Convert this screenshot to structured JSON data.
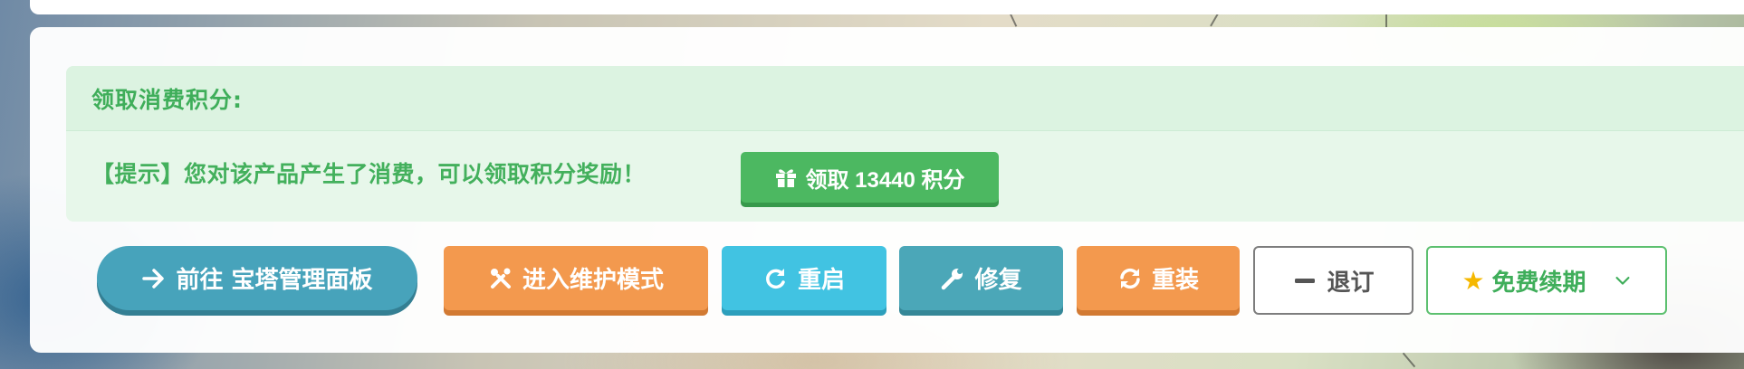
{
  "notice": {
    "title": "领取消费积分:",
    "message": "【提示】您对该产品产生了消费，可以领取积分奖励！",
    "claim_button": "领取 13440 积分"
  },
  "actions": {
    "panel": "前往 宝塔管理面板",
    "maintenance": "进入维护模式",
    "reboot": "重启",
    "repair": "修复",
    "reinstall": "重装",
    "unsubscribe": "退订",
    "renew": "免费续期"
  },
  "icons": {
    "claim": "gift-icon",
    "panel": "arrow-right-icon",
    "maintenance": "tools-icon",
    "reboot": "redo-icon",
    "repair": "wrench-icon",
    "reinstall": "sync-icon",
    "unsubscribe": "minus-icon",
    "renew": "star-icon",
    "renew_caret": "chevron-down-icon"
  },
  "colors": {
    "success": "#4cb861",
    "panel": "#47a3bb",
    "warning": "#f3994e",
    "info": "#41c3e2",
    "repair": "#4ba7b8"
  }
}
